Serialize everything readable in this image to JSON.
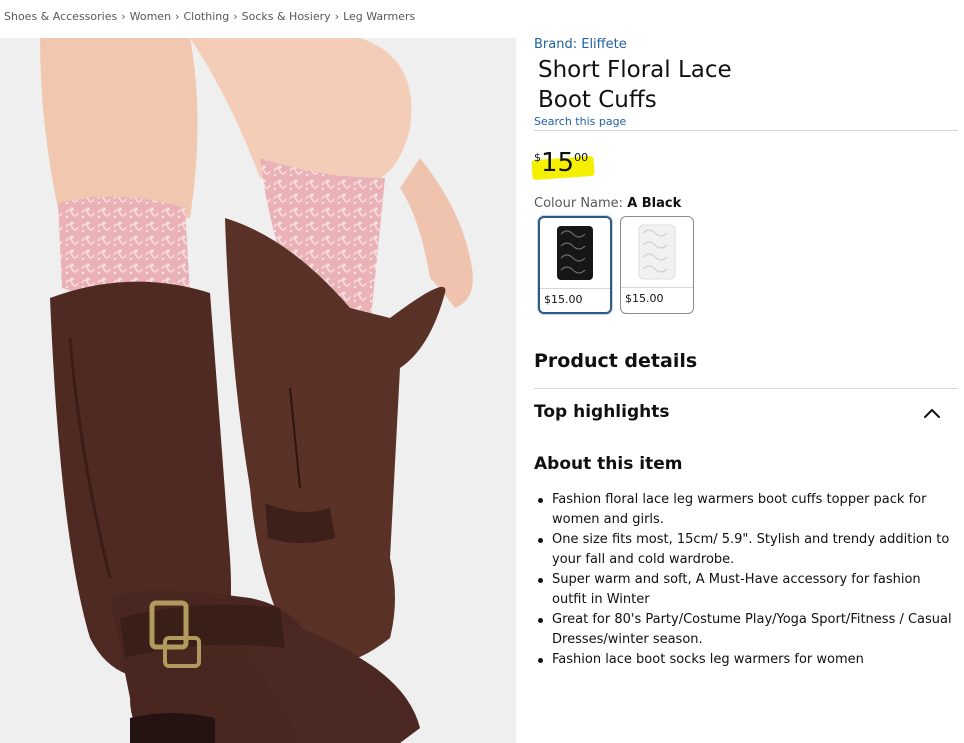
{
  "breadcrumb": {
    "items": [
      "Shoes & Accessories",
      "Women",
      "Clothing",
      "Socks & Hosiery",
      "Leg Warmers"
    ],
    "separator": "›"
  },
  "product": {
    "brand": "Brand: Eliffete",
    "title_line1": "Short Floral Lace",
    "title_line2": "Boot Cuffs",
    "search_link": "Search this page",
    "price": {
      "symbol": "$",
      "whole": "15",
      "fraction": "00",
      "highlight_color": "#f4f000"
    }
  },
  "colour": {
    "label": "Colour Name:",
    "selected": "A Black",
    "options": [
      {
        "name": "A Black",
        "price": "$15.00",
        "swatch_color": "#111111"
      },
      {
        "name": "White",
        "price": "$15.00",
        "swatch_color": "#f4f4f4"
      }
    ]
  },
  "sections": {
    "details": "Product details",
    "top_highlights": "Top highlights",
    "about": "About this item"
  },
  "about_bullets": [
    "Fashion floral lace leg warmers boot cuffs topper pack for women and girls.",
    "One size fits most, 15cm/ 5.9\". Stylish and trendy addition to your fall and cold wardrobe.",
    "Super warm and soft, A Must-Have accessory for fashion outfit in Winter",
    "Great for 80's Party/Costume Play/Yoga Sport/Fitness / Casual Dresses/winter season.",
    "Fashion lace boot socks leg warmers for women"
  ],
  "icons": {
    "chevron": "chevron-up-icon"
  },
  "colors": {
    "link": "#2162a1",
    "text": "#0f1111",
    "selected_border": "#2f5a86"
  }
}
